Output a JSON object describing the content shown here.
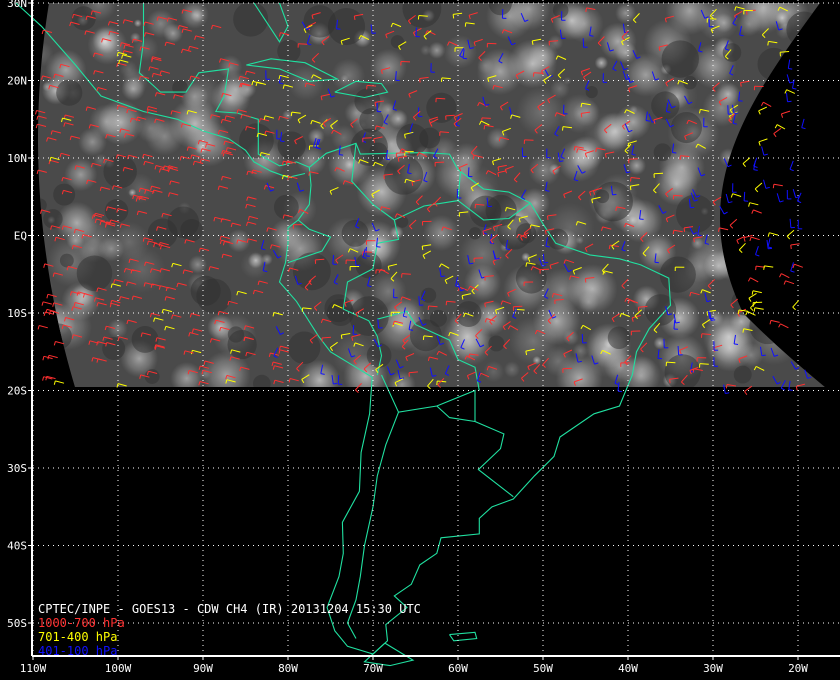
{
  "title": "CPTEC/INPE - GOES13 - CDW CH4 (IR) 20131204 15:30 UTC",
  "legend": [
    {
      "label": "1000-700 hPa",
      "color": "#ff3030"
    },
    {
      "label": "701-400 hPa",
      "color": "#ffff00"
    },
    {
      "label": "401-100 hPa",
      "color": "#1010ff"
    }
  ],
  "coast_color": "#20e0a0",
  "lat_labels": [
    "30N",
    "20N",
    "10N",
    "EQ",
    "10S",
    "20S",
    "30S",
    "40S",
    "50S"
  ],
  "lat_values": [
    30,
    20,
    10,
    0,
    -10,
    -20,
    -30,
    -40,
    -50
  ],
  "lon_labels": [
    "110W",
    "100W",
    "90W",
    "80W",
    "70W",
    "60W",
    "50W",
    "40W",
    "30W",
    "20W"
  ],
  "lon_values": [
    -110,
    -100,
    -90,
    -80,
    -70,
    -60,
    -50,
    -40,
    -30,
    -20
  ],
  "extent": {
    "lon_min": -110,
    "lon_max": -17,
    "lat_min": -56,
    "lat_max": 30
  },
  "imagery_extent": {
    "lat_min": -20,
    "lat_max": 30
  }
}
